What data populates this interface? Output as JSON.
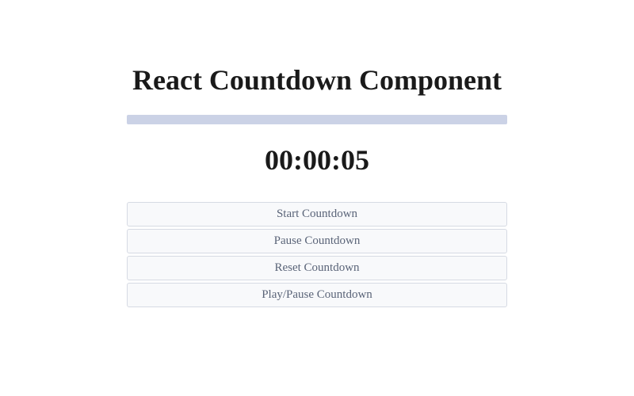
{
  "title": "React Countdown Component",
  "countdown": {
    "display": "00:00:05",
    "progress_percent": 100
  },
  "buttons": {
    "start": "Start Countdown",
    "pause": "Pause Countdown",
    "reset": "Reset Countdown",
    "toggle": "Play/Pause Countdown"
  }
}
